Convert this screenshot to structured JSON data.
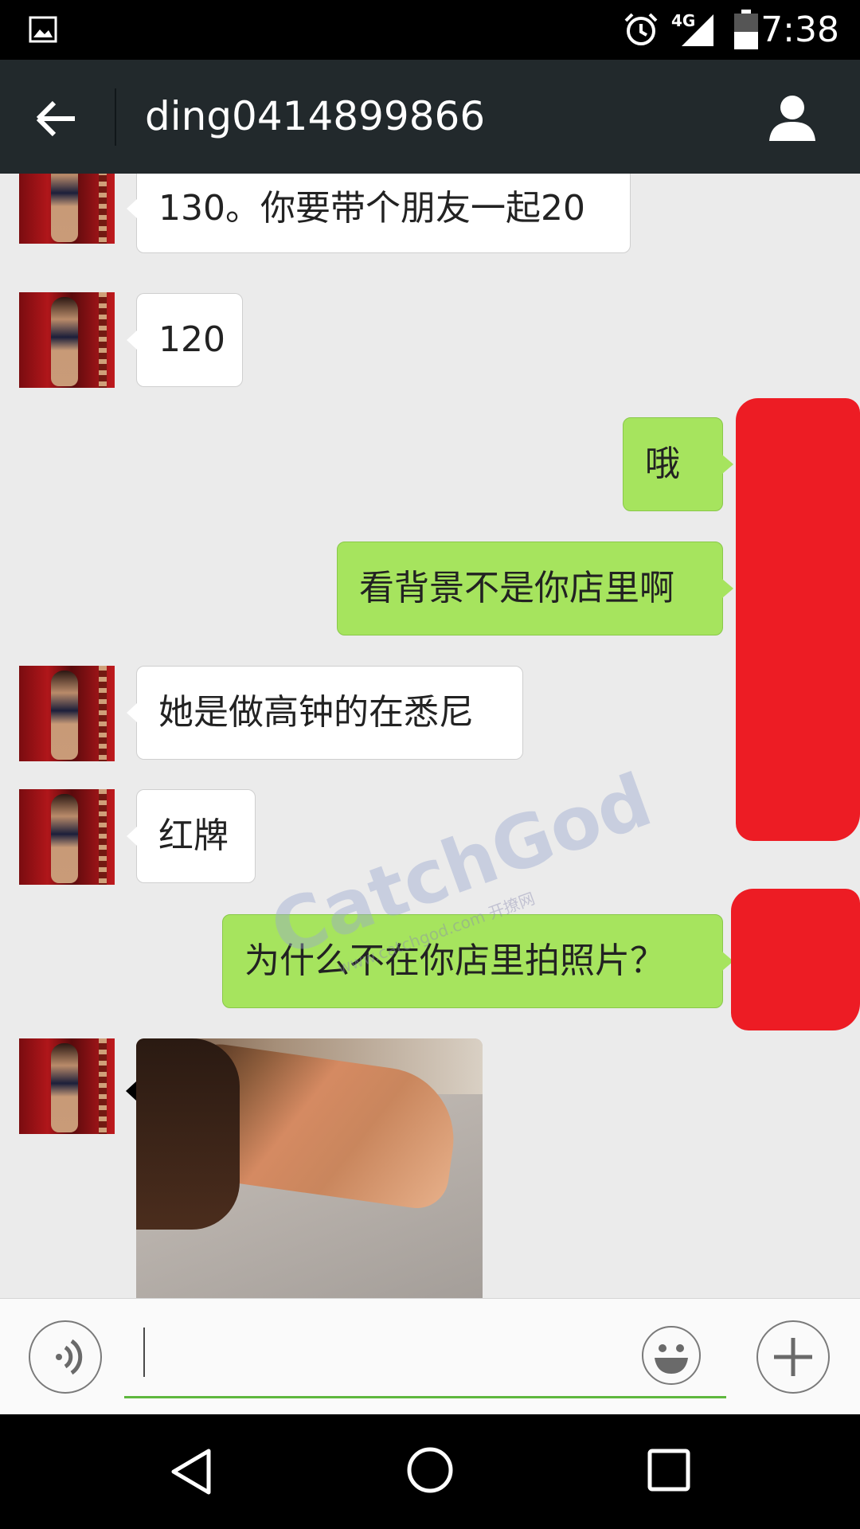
{
  "status_bar": {
    "network": "4G",
    "time": "7:38",
    "icons": [
      "image-icon",
      "alarm-icon",
      "signal-icon",
      "battery-icon"
    ]
  },
  "header": {
    "title": "ding0414899866",
    "back_icon": "arrow-left-icon",
    "profile_icon": "person-icon"
  },
  "messages": [
    {
      "direction": "incoming",
      "type": "text",
      "text": "130。你要带个朋友一起20"
    },
    {
      "direction": "incoming",
      "type": "text",
      "text": "120"
    },
    {
      "direction": "outgoing",
      "type": "text",
      "text": "哦"
    },
    {
      "direction": "outgoing",
      "type": "text",
      "text": "看背景不是你店里啊"
    },
    {
      "direction": "incoming",
      "type": "text",
      "text": "她是做高钟的在悉尼"
    },
    {
      "direction": "incoming",
      "type": "text",
      "text": "红牌"
    },
    {
      "direction": "outgoing",
      "type": "text",
      "text": "为什么不在你店里拍照片？"
    },
    {
      "direction": "incoming",
      "type": "image"
    }
  ],
  "watermark": {
    "main": "CatchGod",
    "sub": "www.catchgod.com 开撩网"
  },
  "input_bar": {
    "voice_icon": "voice-icon",
    "emoji_icon": "smiley-icon",
    "plus_icon": "plus-icon",
    "input_value": ""
  },
  "colors": {
    "outgoing_bubble": "#a6e45e",
    "incoming_bubble": "#ffffff",
    "header_bg": "#22292c",
    "input_underline": "#5fb83e"
  },
  "nav_bar": {
    "icons": [
      "back-triangle-icon",
      "home-circle-icon",
      "recents-square-icon"
    ]
  }
}
